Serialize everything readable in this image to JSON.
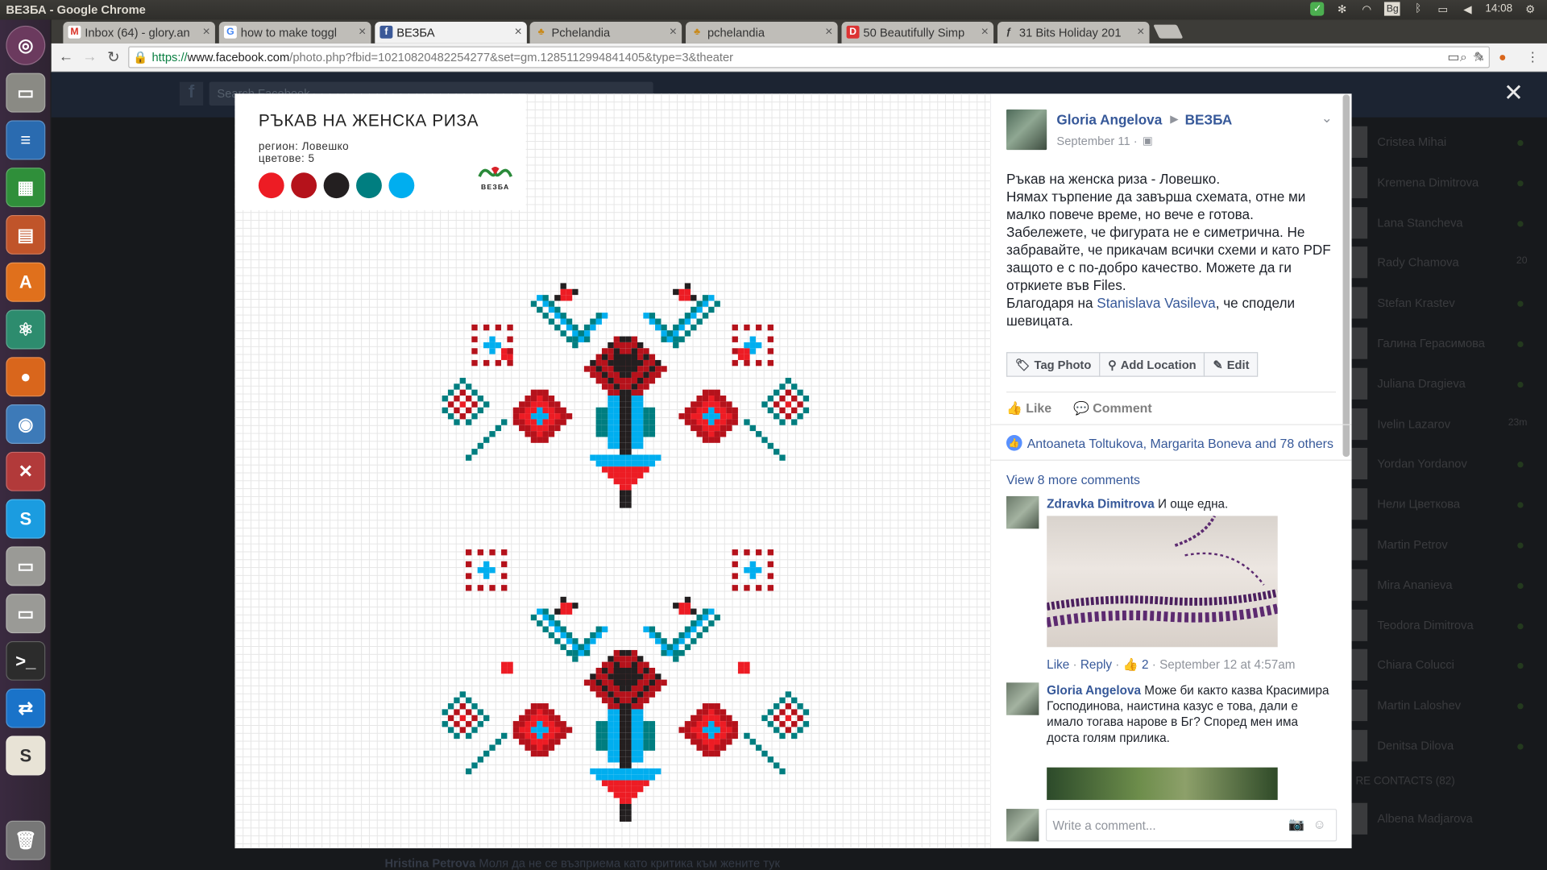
{
  "window_title": "ВЕЗБА - Google Chrome",
  "clock": "14:08",
  "tray_lang": "Bg",
  "tabs": [
    {
      "label": "Inbox (64) - glory.an",
      "icon": "gmail-icon"
    },
    {
      "label": "how to make toggl",
      "icon": "google-icon"
    },
    {
      "label": "ВЕЗБА",
      "icon": "facebook-icon",
      "active": true
    },
    {
      "label": "Pchelandia",
      "icon": "bee-icon"
    },
    {
      "label": "pchelandia",
      "icon": "bee-icon"
    },
    {
      "label": "50 Beautifully Simp",
      "icon": "di-icon"
    },
    {
      "label": "31 Bits Holiday 201",
      "icon": "f-icon"
    }
  ],
  "url": {
    "scheme": "https://",
    "host": "www.facebook.com",
    "path": "/photo.php?fbid=10210820482254277&set=gm.1285112994841405&type=3&theater"
  },
  "fb_search_placeholder": "Search Facebook",
  "photo": {
    "title": "РЪКАВ НА ЖЕНСКА РИЗА",
    "region": "регион: Ловешко",
    "colors_label": "цветове: 5",
    "logo_text": "ВЕЗБА",
    "swatches": [
      "#ed1c24",
      "#b5121b",
      "#231f20",
      "#007e80",
      "#00aeef"
    ]
  },
  "post": {
    "author": "Gloria Angelova",
    "group": "ВЕЗБА",
    "date": "September 11 ·",
    "lines": [
      "Ръкав на женска риза - Ловешко.",
      "Нямах търпение да завърша схемата, отне ми малко повече време, но вече е готова.",
      "Забележете, че фигурата не е симетрична. Не забравайте, че прикачам всички схеми и като PDF защото е с по-добро качество. Можете да ги отркиете във Files."
    ],
    "thanks_prefix": "Благодаря на ",
    "thanks_name": "Stanislava Vasileva",
    "thanks_suffix": ", че сподели шевицата."
  },
  "buttons": {
    "tag": "Tag Photo",
    "location": "Add Location",
    "edit": "Edit"
  },
  "actions": {
    "like": "Like",
    "comment": "Comment"
  },
  "likes_text": "Antoaneta Toltukova, Margarita Boneva and 78 others",
  "view_more": "View 8 more comments",
  "comments": [
    {
      "author": "Zdravka Dimitrova",
      "text": "И още една.",
      "like": "Like",
      "reply": "Reply",
      "count": "2",
      "time": "September 12 at 4:57am"
    },
    {
      "author": "Gloria Angelova",
      "text": "Може би както казва Красимира Господинова, наистина казус е това, дали е имало тогава нарове в Бг? Според мен има доста голям прилика."
    }
  ],
  "write_comment": "Write a comment...",
  "chat_contacts": [
    "Cristea Mihai",
    "Kremena Dimitrova",
    "Lana Stancheva",
    "Rady Chamova",
    "Stefan Krastev",
    "Галина Герасимова",
    "Juliana Dragieva",
    "Ivelin Lazarov",
    "Yordan Yordanov",
    "Нели Цветкова",
    "Martin Petrov",
    "Mira Ananieva",
    "Teodora Dimitrova",
    "Chiara Colucci",
    "Martin Laloshev",
    "Denitsa Dilova"
  ],
  "chat_time_labels": [
    "20",
    "23m"
  ],
  "more_contacts": "RE CONTACTS (82)",
  "more_contacts_bottom": "Albena Madjarova",
  "behind_post": {
    "name": "Hristina Petrova",
    "text": "Моля да не се възприема като критика към жените тук"
  }
}
